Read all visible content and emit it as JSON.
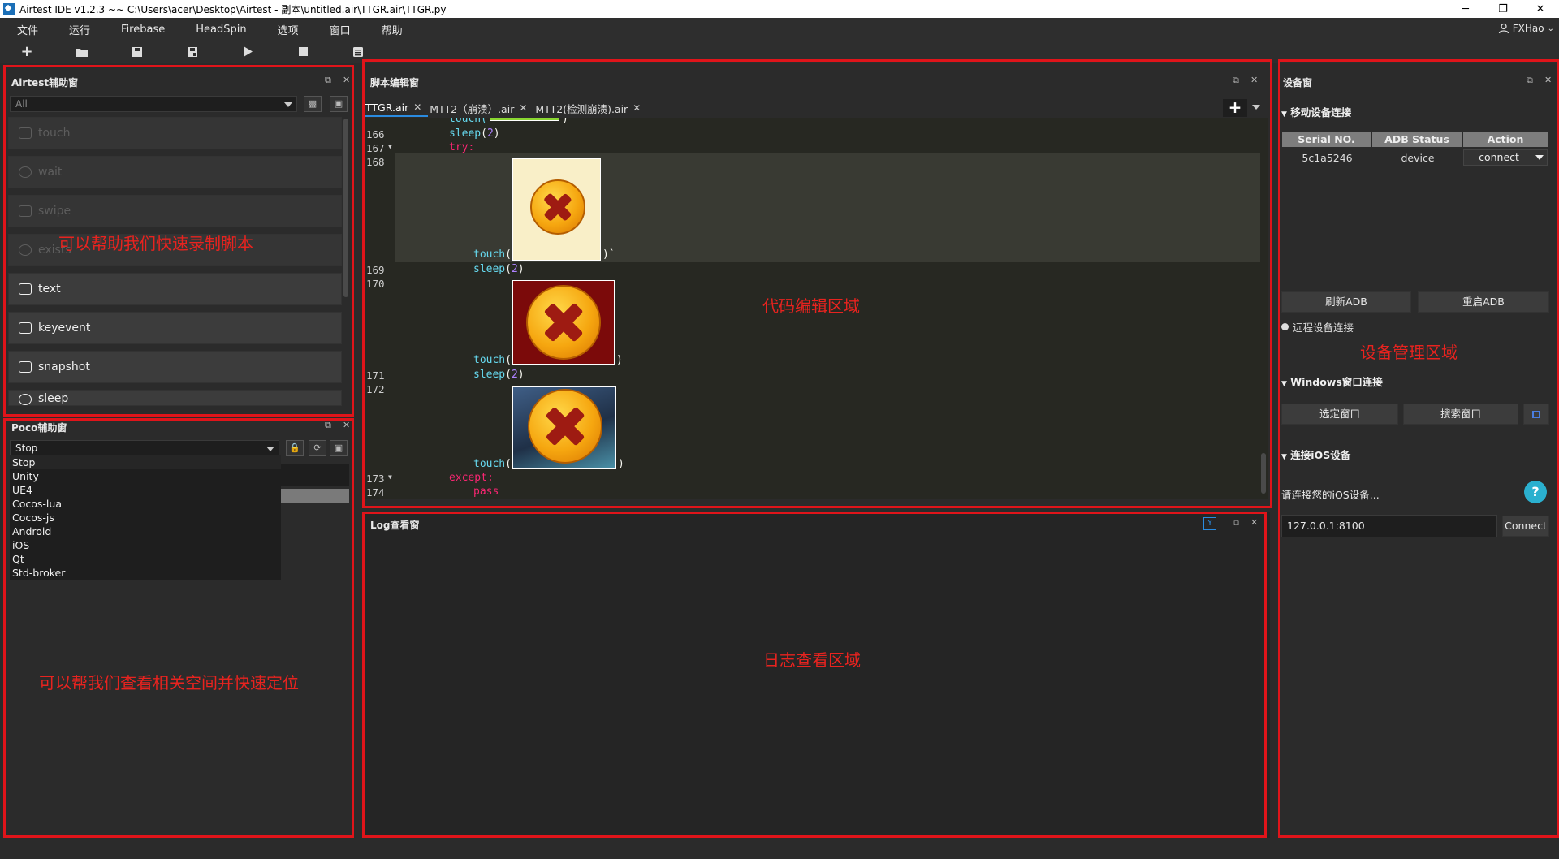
{
  "window": {
    "title": "Airtest IDE v1.2.3 ~~ C:\\Users\\acer\\Desktop\\Airtest - 副本\\untitled.air\\TTGR.air\\TTGR.py",
    "minimize": "─",
    "maximize": "❐",
    "close": "✕"
  },
  "menu": {
    "items": [
      "文件",
      "运行",
      "Firebase",
      "HeadSpin",
      "选项",
      "窗口",
      "帮助"
    ],
    "user": "FXHao"
  },
  "airtest_panel": {
    "title": "Airtest辅助窗",
    "filter_value": "All",
    "buttons": [
      "touch",
      "wait",
      "swipe",
      "exists",
      "text",
      "keyevent",
      "snapshot",
      "sleep"
    ],
    "annotation": "可以帮助我们快速录制脚本"
  },
  "poco_panel": {
    "title": "Poco辅助窗",
    "selected": "Stop",
    "options": [
      "Stop",
      "Unity",
      "UE4",
      "Cocos-lua",
      "Cocos-js",
      "Android",
      "iOS",
      "Qt",
      "Std-broker"
    ],
    "annotation": "可以帮我们查看相关空间并快速定位"
  },
  "editor": {
    "title": "脚本编辑窗",
    "tabs": [
      "TTGR.air",
      "MTT2（崩溃）.air",
      "MTT2(检测崩溃).air"
    ],
    "line_numbers": [
      "166",
      "167",
      "168",
      "169",
      "170",
      "171",
      "172",
      "173",
      "174"
    ],
    "code": {
      "l165": "touch(",
      "l166_fn": "sleep",
      "l166_num": "2",
      "l167": "try:",
      "l168_fn": "touch",
      "l169_fn": "sleep",
      "l169_num": "2",
      "l170_fn": "touch",
      "l171_fn": "sleep",
      "l171_num": "2",
      "l172_fn": "touch",
      "l173": "except:",
      "l174": "pass"
    },
    "annotation": "代码编辑区域"
  },
  "log_panel": {
    "title": "Log查看窗",
    "annotation": "日志查看区域"
  },
  "device_panel": {
    "title": "设备窗",
    "mobile_section": "移动设备连接",
    "columns": [
      "Serial NO.",
      "ADB Status",
      "Action"
    ],
    "devices": [
      {
        "serial": "5c1a5246",
        "status": "device",
        "action": "connect"
      }
    ],
    "refresh_adb": "刷新ADB",
    "restart_adb": "重启ADB",
    "remote_connect": "远程设备连接",
    "windows_section": "Windows窗口连接",
    "select_window": "选定窗口",
    "search_window": "搜索窗口",
    "ios_section": "连接iOS设备",
    "ios_hint": "请连接您的iOS设备...",
    "ios_address": "127.0.0.1:8100",
    "ios_connect": "Connect",
    "annotation": "设备管理区域"
  },
  "colors": {
    "accent": "#2a8be0",
    "annotation_red": "#e0141a",
    "keyword": "#f92672",
    "function": "#66d9ef",
    "number": "#ae81ff"
  }
}
